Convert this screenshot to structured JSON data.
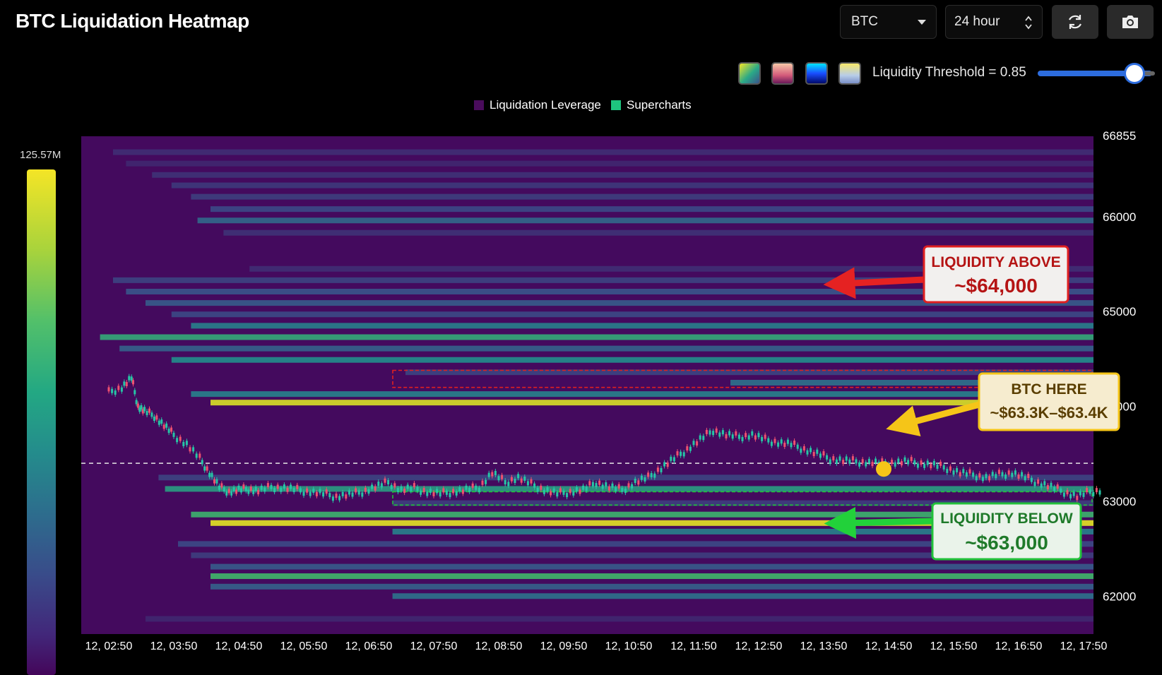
{
  "header": {
    "title": "BTC Liquidation Heatmap"
  },
  "controls": {
    "asset_select": "BTC",
    "range_select": "24 hour",
    "threshold_label": "Liquidity Threshold = 0.85",
    "threshold_value": 0.85,
    "palettes": [
      "viridis",
      "sunset",
      "blue-ice",
      "pastel"
    ],
    "refresh_icon": "refresh-icon",
    "camera_icon": "camera-icon"
  },
  "legend": {
    "items": [
      {
        "label": "Liquidation Leverage",
        "color": "#4a0c5c"
      },
      {
        "label": "Supercharts",
        "color": "#1ec47e"
      }
    ]
  },
  "colorbar": {
    "max_label": "125.57M"
  },
  "chart_data": {
    "type": "heatmap",
    "title": "BTC Liquidation Heatmap",
    "x_ticks": [
      "12, 02:50",
      "12, 03:50",
      "12, 04:50",
      "12, 05:50",
      "12, 06:50",
      "12, 07:50",
      "12, 08:50",
      "12, 09:50",
      "12, 10:50",
      "12, 11:50",
      "12, 12:50",
      "12, 13:50",
      "12, 14:50",
      "12, 15:50",
      "12, 16:50",
      "12, 17:50"
    ],
    "y_ticks": [
      66855,
      66000,
      65000,
      64000,
      63000,
      62000
    ],
    "y_range": [
      61600,
      66855
    ],
    "liquidation_bands": [
      {
        "price": 66680,
        "start": 0.5,
        "end": 15.5,
        "intensity": 0.12
      },
      {
        "price": 66560,
        "start": 0.7,
        "end": 15.5,
        "intensity": 0.1
      },
      {
        "price": 66440,
        "start": 1.1,
        "end": 15.5,
        "intensity": 0.14
      },
      {
        "price": 66330,
        "start": 1.4,
        "end": 15.5,
        "intensity": 0.16
      },
      {
        "price": 66210,
        "start": 1.7,
        "end": 15.5,
        "intensity": 0.18
      },
      {
        "price": 66080,
        "start": 2.0,
        "end": 15.5,
        "intensity": 0.22
      },
      {
        "price": 65960,
        "start": 1.8,
        "end": 15.5,
        "intensity": 0.32
      },
      {
        "price": 65830,
        "start": 2.2,
        "end": 15.5,
        "intensity": 0.14
      },
      {
        "price": 65450,
        "start": 2.6,
        "end": 15.5,
        "intensity": 0.12
      },
      {
        "price": 65330,
        "start": 0.5,
        "end": 15.5,
        "intensity": 0.2
      },
      {
        "price": 65210,
        "start": 0.7,
        "end": 15.5,
        "intensity": 0.26
      },
      {
        "price": 65090,
        "start": 1.0,
        "end": 15.5,
        "intensity": 0.28
      },
      {
        "price": 64970,
        "start": 1.4,
        "end": 15.5,
        "intensity": 0.22
      },
      {
        "price": 64850,
        "start": 1.7,
        "end": 15.5,
        "intensity": 0.4
      },
      {
        "price": 64730,
        "start": 0.3,
        "end": 15.5,
        "intensity": 0.55
      },
      {
        "price": 64610,
        "start": 0.6,
        "end": 15.5,
        "intensity": 0.3
      },
      {
        "price": 64490,
        "start": 1.4,
        "end": 15.5,
        "intensity": 0.44
      },
      {
        "price": 64360,
        "start": 5.0,
        "end": 15.5,
        "intensity": 0.2
      },
      {
        "price": 64250,
        "start": 10.0,
        "end": 15.5,
        "intensity": 0.35
      },
      {
        "price": 64130,
        "start": 1.7,
        "end": 15.5,
        "intensity": 0.4
      },
      {
        "price": 64040,
        "start": 2.0,
        "end": 15.5,
        "intensity": 0.92
      },
      {
        "price": 63250,
        "start": 1.2,
        "end": 15.5,
        "intensity": 0.2
      },
      {
        "price": 63130,
        "start": 1.3,
        "end": 15.5,
        "intensity": 0.5
      },
      {
        "price": 62980,
        "start": 4.8,
        "end": 15.5,
        "intensity": 0.18
      },
      {
        "price": 62860,
        "start": 1.7,
        "end": 15.5,
        "intensity": 0.6
      },
      {
        "price": 62770,
        "start": 2.0,
        "end": 15.5,
        "intensity": 0.95
      },
      {
        "price": 62680,
        "start": 4.8,
        "end": 15.5,
        "intensity": 0.4
      },
      {
        "price": 62550,
        "start": 1.5,
        "end": 15.5,
        "intensity": 0.22
      },
      {
        "price": 62430,
        "start": 1.7,
        "end": 15.5,
        "intensity": 0.18
      },
      {
        "price": 62310,
        "start": 2.0,
        "end": 15.5,
        "intensity": 0.28
      },
      {
        "price": 62210,
        "start": 2.0,
        "end": 15.5,
        "intensity": 0.62
      },
      {
        "price": 62100,
        "start": 2.0,
        "end": 15.5,
        "intensity": 0.3
      },
      {
        "price": 62000,
        "start": 4.8,
        "end": 15.5,
        "intensity": 0.35
      },
      {
        "price": 61760,
        "start": 1.0,
        "end": 15.5,
        "intensity": 0.1
      }
    ],
    "price_series": {
      "name": "BTC",
      "x": [
        0,
        0.2,
        0.35,
        0.45,
        0.55,
        0.7,
        0.85,
        1,
        1.2,
        1.4,
        1.55,
        1.7,
        1.85,
        2,
        2.15,
        2.3,
        2.5,
        2.7,
        2.9,
        3.1,
        3.3,
        3.5,
        3.7,
        3.9,
        4.1,
        4.3,
        4.5,
        4.7,
        4.9,
        5.1,
        5.3,
        5.5,
        5.7,
        5.9,
        6.1,
        6.3,
        6.5,
        6.7,
        6.9,
        7.1,
        7.3,
        7.5,
        7.7,
        7.9,
        8.1,
        8.3,
        8.5,
        8.7,
        8.9,
        9.1,
        9.3,
        9.5,
        9.7,
        9.9,
        10.1,
        10.3,
        10.5,
        10.7,
        10.9,
        11.1,
        11.3,
        11.5,
        11.7,
        11.9,
        12.1,
        12.3,
        12.5,
        12.7,
        12.9,
        13.1,
        13.3,
        13.5,
        13.7,
        13.9,
        14.1,
        14.3,
        14.5,
        14.7,
        14.9,
        15.1,
        15.3
      ],
      "y": [
        64150,
        64200,
        64300,
        64000,
        63950,
        63900,
        63800,
        63700,
        63600,
        63450,
        63300,
        63150,
        63100,
        63120,
        63130,
        63110,
        63150,
        63140,
        63120,
        63100,
        63080,
        63050,
        63070,
        63100,
        63150,
        63200,
        63120,
        63140,
        63100,
        63080,
        63100,
        63120,
        63150,
        63300,
        63200,
        63250,
        63180,
        63120,
        63080,
        63100,
        63120,
        63200,
        63150,
        63120,
        63200,
        63250,
        63350,
        63450,
        63550,
        63650,
        63750,
        63700,
        63680,
        63700,
        63650,
        63620,
        63600,
        63550,
        63500,
        63450,
        63430,
        63420,
        63410,
        63400,
        63410,
        63420,
        63400,
        63380,
        63350,
        63300,
        63280,
        63250,
        63280,
        63300,
        63250,
        63200,
        63150,
        63100,
        63050,
        63100,
        63120
      ],
      "current_price": 63340
    },
    "reference_line": 63400,
    "zones": [
      {
        "type": "resistance-box",
        "from": 64200,
        "to": 64380
      },
      {
        "type": "support-box",
        "from": 62960,
        "to": 63100
      }
    ],
    "annotations": [
      {
        "heading": "LIQUIDITY ABOVE",
        "value": "~$64,000",
        "color": "#e02020"
      },
      {
        "heading": "BTC HERE",
        "value": "~$63.3K–$63.4K",
        "color": "#f5c518"
      },
      {
        "heading": "LIQUIDITY BELOW",
        "value": "~$63,000",
        "color": "#22c13a"
      }
    ]
  }
}
